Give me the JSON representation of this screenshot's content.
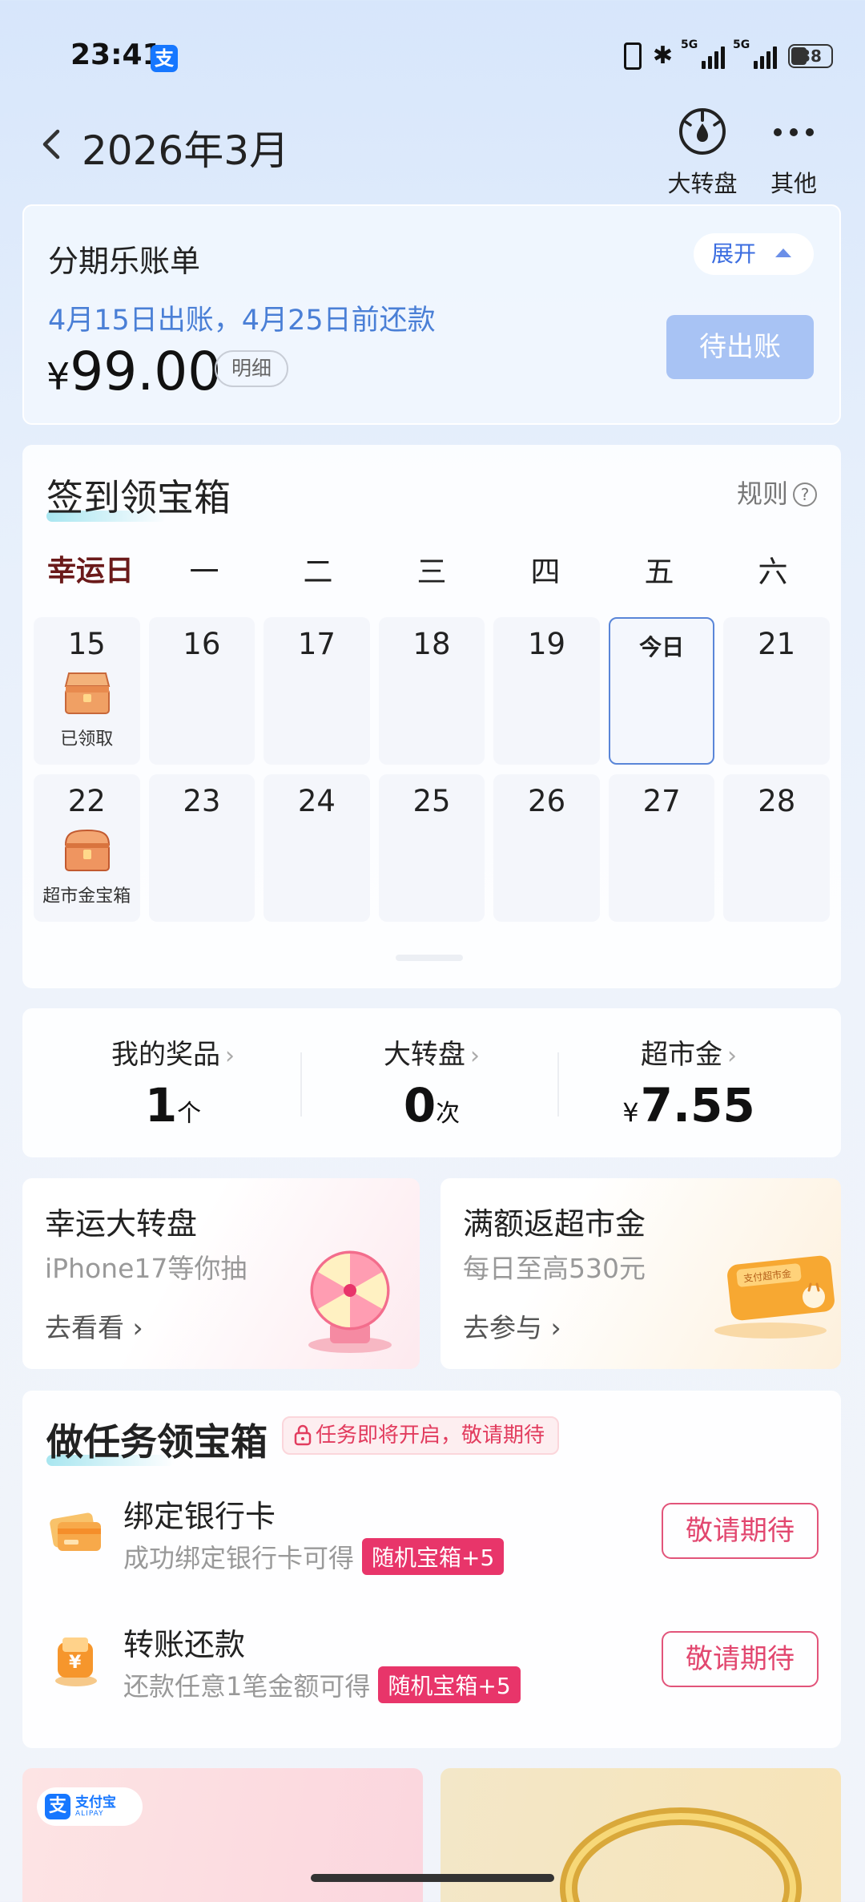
{
  "status_bar": {
    "time": "23:41",
    "battery": "38",
    "net1": "5G",
    "net2": "5G"
  },
  "header": {
    "title": "2026年3月",
    "wheel_label": "大转盘",
    "more_label": "其他"
  },
  "bill": {
    "title": "分期乐账单",
    "expand_label": "展开",
    "date_text": "4月15日出账，4月25日前还款",
    "currency": "¥",
    "amount": "99.00",
    "detail_label": "明细",
    "status_button": "待出账"
  },
  "signin": {
    "title": "签到领宝箱",
    "rule_label": "规则",
    "rule_icon": "?",
    "weekdays": [
      "幸运日",
      "一",
      "二",
      "三",
      "四",
      "五",
      "六"
    ],
    "week1": [
      {
        "day": "15",
        "label": "已领取"
      },
      {
        "day": "16"
      },
      {
        "day": "17"
      },
      {
        "day": "18"
      },
      {
        "day": "19"
      },
      {
        "day": "今日"
      },
      {
        "day": "21"
      }
    ],
    "week2": [
      {
        "day": "22",
        "label": "超市金宝箱"
      },
      {
        "day": "23"
      },
      {
        "day": "24"
      },
      {
        "day": "25"
      },
      {
        "day": "26"
      },
      {
        "day": "27"
      },
      {
        "day": "28"
      }
    ]
  },
  "stats": {
    "prizes": {
      "label": "我的奖品",
      "value": "1",
      "unit": "个"
    },
    "wheel": {
      "label": "大转盘",
      "value": "0",
      "unit": "次"
    },
    "market": {
      "label": "超市金",
      "currency": "¥",
      "value": "7.55"
    }
  },
  "promos": {
    "left": {
      "title": "幸运大转盘",
      "subtitle": "iPhone17等你抽",
      "action": "去看看"
    },
    "right": {
      "title": "满额返超市金",
      "subtitle": "每日至高530元",
      "action": "去参与",
      "badge": "支付超市金"
    }
  },
  "tasks": {
    "title": "做任务领宝箱",
    "lock_notice": "任务即将开启，敬请期待",
    "items": [
      {
        "name": "绑定银行卡",
        "desc": "成功绑定银行卡可得",
        "reward": "随机宝箱+5",
        "button": "敬请期待"
      },
      {
        "name": "转账还款",
        "desc": "还款任意1笔金额可得",
        "reward": "随机宝箱+5",
        "button": "敬请期待"
      }
    ]
  },
  "banner": {
    "logo_cn": "支付宝",
    "logo_en": "ALIPAY"
  },
  "colors": {
    "accent": "#3b6de0",
    "task_red": "#e8356a",
    "pending_btn": "#a8c3f4"
  }
}
